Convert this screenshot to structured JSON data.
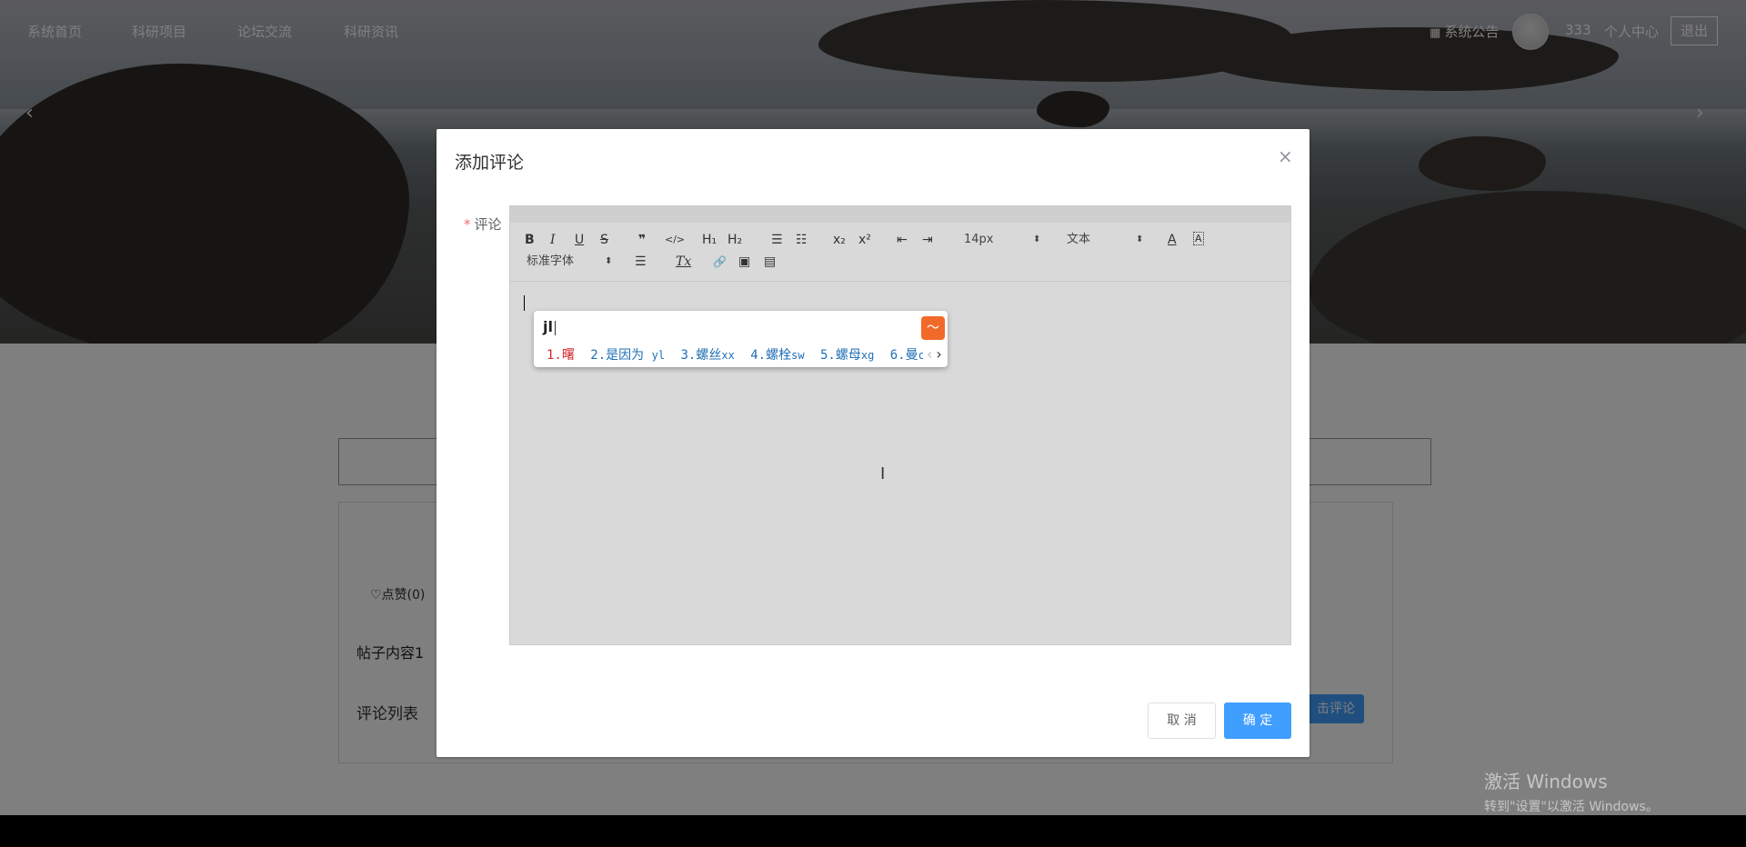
{
  "nav": {
    "items": [
      "系统首页",
      "科研项目",
      "论坛交流",
      "科研资讯"
    ],
    "notice": "系统公告",
    "username": "333",
    "profile": "个人中心",
    "logout": "退出"
  },
  "carousel": {
    "prev": "‹",
    "next": "›"
  },
  "page": {
    "like": "♡点赞(0)",
    "post_content": "帖子内容1",
    "comment_list": "评论列表",
    "comment_button": "击评论"
  },
  "dialog": {
    "title": "添加评论",
    "close": "×",
    "label": "评论",
    "required_mark": "*",
    "cancel": "取 消",
    "confirm": "确 定"
  },
  "toolbar": {
    "bold": "B",
    "italic": "I",
    "underline": "U",
    "strike": "S",
    "quote": "❞",
    "code": "</>",
    "h1": "H₁",
    "h2": "H₂",
    "ordered_list": "☰",
    "bullet_list": "☷",
    "subscript": "x₂",
    "superscript": "x²",
    "outdent": "⇤",
    "indent": "⇥",
    "size": "14px",
    "header": "文本",
    "font_color": "A",
    "background": "A",
    "font": "标准字体",
    "align": "☰",
    "clean": "Tx",
    "link": "🔗",
    "image": "▣",
    "video": "▤"
  },
  "ime": {
    "input": "jl",
    "candidates": [
      {
        "n": "1.",
        "word": "曙",
        "code": ""
      },
      {
        "n": "2.",
        "word": "是因为",
        "code": "yl"
      },
      {
        "n": "3.",
        "word": "螺丝",
        "code": "xx"
      },
      {
        "n": "4.",
        "word": "螺栓",
        "code": "sw"
      },
      {
        "n": "5.",
        "word": "螺母",
        "code": "xg"
      },
      {
        "n": "6.",
        "word": "曼",
        "code": "c"
      }
    ],
    "prev": "‹",
    "next": "›"
  },
  "watermark": {
    "line1": "激活 Windows",
    "line2": "转到\"设置\"以激活 Windows。"
  }
}
